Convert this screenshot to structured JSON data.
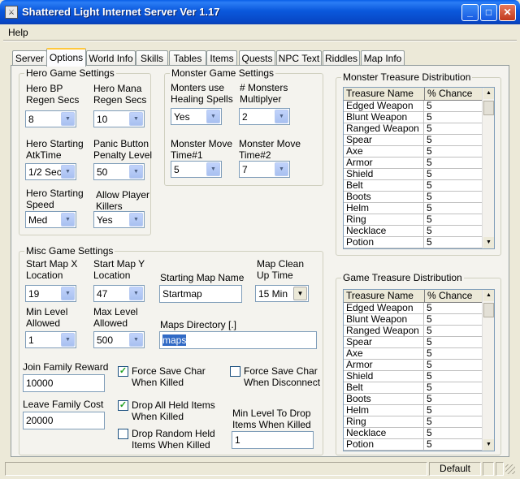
{
  "window": {
    "title": "Shattered Light Internet Server Ver 1.17",
    "minimize_label": "_",
    "maximize_label": "□",
    "close_label": "✕"
  },
  "menu": {
    "help": "Help"
  },
  "tabs": [
    "Server",
    "Options",
    "World Info",
    "Skills",
    "Tables",
    "Items",
    "Quests",
    "NPC Text",
    "Riddles",
    "Map Info"
  ],
  "active_tab": "Options",
  "hero": {
    "title": "Hero Game Settings",
    "bp_regen_label": "Hero BP\nRegen Secs",
    "bp_regen_value": "8",
    "mana_regen_label": "Hero Mana\nRegen Secs",
    "mana_regen_value": "10",
    "atk_time_label": "Hero Starting\nAtkTime",
    "atk_time_value": "1/2 Sec",
    "panic_label": "Panic Button\nPenalty Level",
    "panic_value": "50",
    "speed_label": "Hero Starting\nSpeed",
    "speed_value": "Med",
    "pk_label": "Allow Player\nKillers",
    "pk_value": "Yes"
  },
  "monster": {
    "title": "Monster Game Settings",
    "healing_label": "Monters use\nHealing Spells",
    "healing_value": "Yes",
    "multiplier_label": "# Monsters\nMultiplyer",
    "multiplier_value": "2",
    "move1_label": "Monster Move\nTime#1",
    "move1_value": "5",
    "move2_label": "Monster Move\nTime#2",
    "move2_value": "7"
  },
  "misc": {
    "title": "Misc Game Settings",
    "start_x_label": "Start Map X\nLocation",
    "start_x_value": "19",
    "start_y_label": "Start Map Y\nLocation",
    "start_y_value": "47",
    "start_map_label": "Starting Map Name",
    "start_map_value": "Startmap",
    "map_clean_label": "Map Clean\nUp Time",
    "map_clean_value": "15 Min",
    "min_level_label": "Min Level\nAllowed",
    "min_level_value": "1",
    "max_level_label": "Max Level\nAllowed",
    "max_level_value": "500",
    "maps_dir_label": "Maps Directory [.]",
    "maps_dir_value": "maps",
    "join_reward_label": "Join Family Reward",
    "join_reward_value": "10000",
    "leave_cost_label": "Leave Family Cost",
    "leave_cost_value": "20000",
    "force_save_killed_label": "Force Save Char\nWhen Killed",
    "force_save_killed_checked": true,
    "force_save_disconnect_label": "Force Save Char\nWhen Disconnect",
    "force_save_disconnect_checked": false,
    "drop_all_label": "Drop All Held Items\nWhen Killed",
    "drop_all_checked": true,
    "drop_random_label": "Drop Random Held\nItems When Killed",
    "drop_random_checked": false,
    "min_level_drop_label": "Min Level To Drop\nItems When Killed",
    "min_level_drop_value": "1"
  },
  "monster_treasure": {
    "title": "Monster Treasure Distribution",
    "columns": [
      "Treasure Name",
      "% Chance"
    ],
    "rows": [
      [
        "Edged Weapon",
        "5"
      ],
      [
        "Blunt Weapon",
        "5"
      ],
      [
        "Ranged Weapon",
        "5"
      ],
      [
        "Spear",
        "5"
      ],
      [
        "Axe",
        "5"
      ],
      [
        "Armor",
        "5"
      ],
      [
        "Shield",
        "5"
      ],
      [
        "Belt",
        "5"
      ],
      [
        "Boots",
        "5"
      ],
      [
        "Helm",
        "5"
      ],
      [
        "Ring",
        "5"
      ],
      [
        "Necklace",
        "5"
      ],
      [
        "Potion",
        "5"
      ]
    ]
  },
  "game_treasure": {
    "title": "Game Treasure Distribution",
    "columns": [
      "Treasure Name",
      "% Chance"
    ],
    "rows": [
      [
        "Edged Weapon",
        "5"
      ],
      [
        "Blunt Weapon",
        "5"
      ],
      [
        "Ranged Weapon",
        "5"
      ],
      [
        "Spear",
        "5"
      ],
      [
        "Axe",
        "5"
      ],
      [
        "Armor",
        "5"
      ],
      [
        "Shield",
        "5"
      ],
      [
        "Belt",
        "5"
      ],
      [
        "Boots",
        "5"
      ],
      [
        "Helm",
        "5"
      ],
      [
        "Ring",
        "5"
      ],
      [
        "Necklace",
        "5"
      ],
      [
        "Potion",
        "5"
      ]
    ]
  },
  "status": {
    "panel_label": "Default"
  },
  "icons": {
    "dropdown": "dropdown-arrow-icon",
    "check": "checkmark-icon",
    "scroll_up": "scroll-up-icon",
    "scroll_down": "scroll-down-icon"
  }
}
